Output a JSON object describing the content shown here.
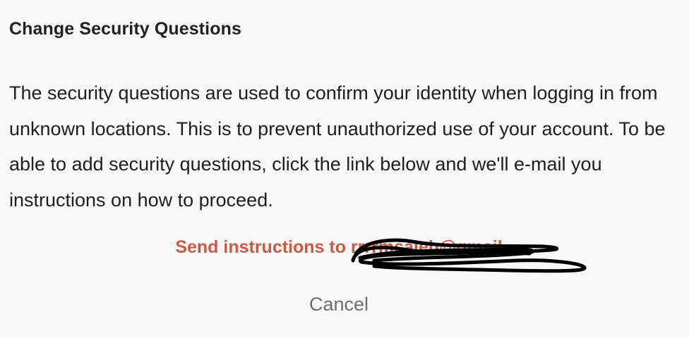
{
  "dialog": {
    "title": "Change Security Questions",
    "description": "The security questions are used to confirm your identity when logging in from unknown locations. This is to prevent unauthorized use of your account. To be able to add security questions, click the link below and we'll e-mail you instructions on how to proceed.",
    "send_link_label": "Send instructions to rrrrmsaleh@gmail",
    "cancel_label": "Cancel"
  },
  "colors": {
    "background": "#f8f8f8",
    "link": "#cb5a45",
    "cancel": "#6e6e6e",
    "text": "#1e1e1e"
  }
}
